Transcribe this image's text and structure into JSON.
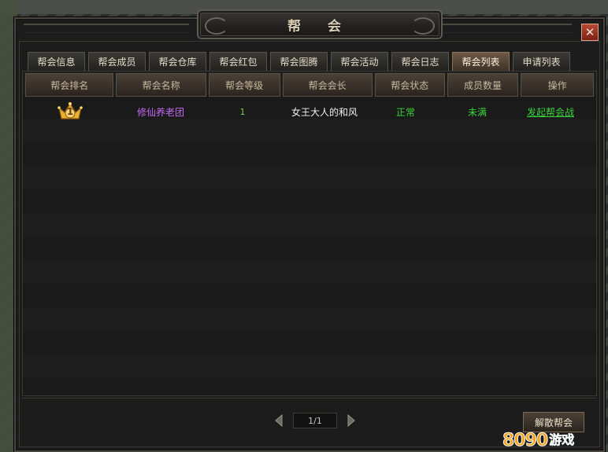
{
  "window": {
    "title": "帮 会",
    "close_label": "✕"
  },
  "tabs": [
    {
      "label": "帮会信息",
      "active": false
    },
    {
      "label": "帮会成员",
      "active": false
    },
    {
      "label": "帮会仓库",
      "active": false
    },
    {
      "label": "帮会红包",
      "active": false
    },
    {
      "label": "帮会图腾",
      "active": false
    },
    {
      "label": "帮会活动",
      "active": false
    },
    {
      "label": "帮会日志",
      "active": false
    },
    {
      "label": "帮会列表",
      "active": true
    },
    {
      "label": "申请列表",
      "active": false
    }
  ],
  "table": {
    "headers": [
      "帮会排名",
      "帮会名称",
      "帮会等级",
      "帮会会长",
      "帮会状态",
      "成员数量",
      "操作"
    ],
    "rows": [
      {
        "rank": "1",
        "rank_icon": "crown-icon",
        "name": "修仙养老团",
        "level": "1",
        "leader": "女王大人的和风",
        "status": "正常",
        "members": "未满",
        "action": "发起帮会战"
      }
    ]
  },
  "pager": {
    "page": "1/1",
    "prev_icon": "arrow-left-icon",
    "next_icon": "arrow-right-icon"
  },
  "footer": {
    "disband_label": "解散帮会"
  },
  "watermark": {
    "number": "8090",
    "text": "游戏"
  },
  "colors": {
    "guild_name": "#c66af0",
    "status_ok": "#3bd43b",
    "level": "#7ccf54"
  }
}
